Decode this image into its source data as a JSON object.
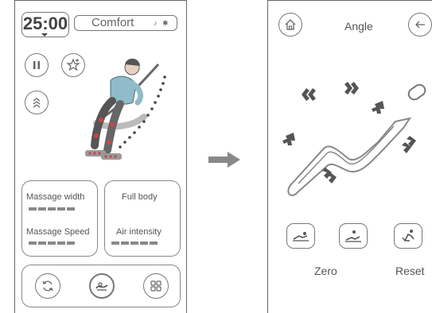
{
  "left_panel": {
    "timer": "25:00",
    "mode": "Comfort",
    "status_icons": "♪ ✱",
    "cards": {
      "left": {
        "label1": "Massage width",
        "label2": "Massage Speed"
      },
      "right": {
        "label1": "Full body",
        "label2": "Air intensity"
      }
    }
  },
  "right_panel": {
    "title": "Angle",
    "labels": {
      "zero": "Zero",
      "reset": "Reset"
    }
  },
  "colors": {
    "stroke": "#777777",
    "text": "#555555",
    "arrow": "#888888"
  },
  "icons": {
    "timer_chevron": "chevron-down-icon",
    "pause": "pause-icon",
    "favorite": "star-add-icon",
    "auto_adjust": "double-chevron-icon",
    "bottom_left": "refresh-icon",
    "bottom_center": "massage-mode-icon",
    "bottom_right": "grid-icon",
    "home": "home-icon",
    "back": "back-icon",
    "zero": "zero-gravity-icon",
    "reset": "reset-icon",
    "transition": "right-arrow-icon"
  }
}
